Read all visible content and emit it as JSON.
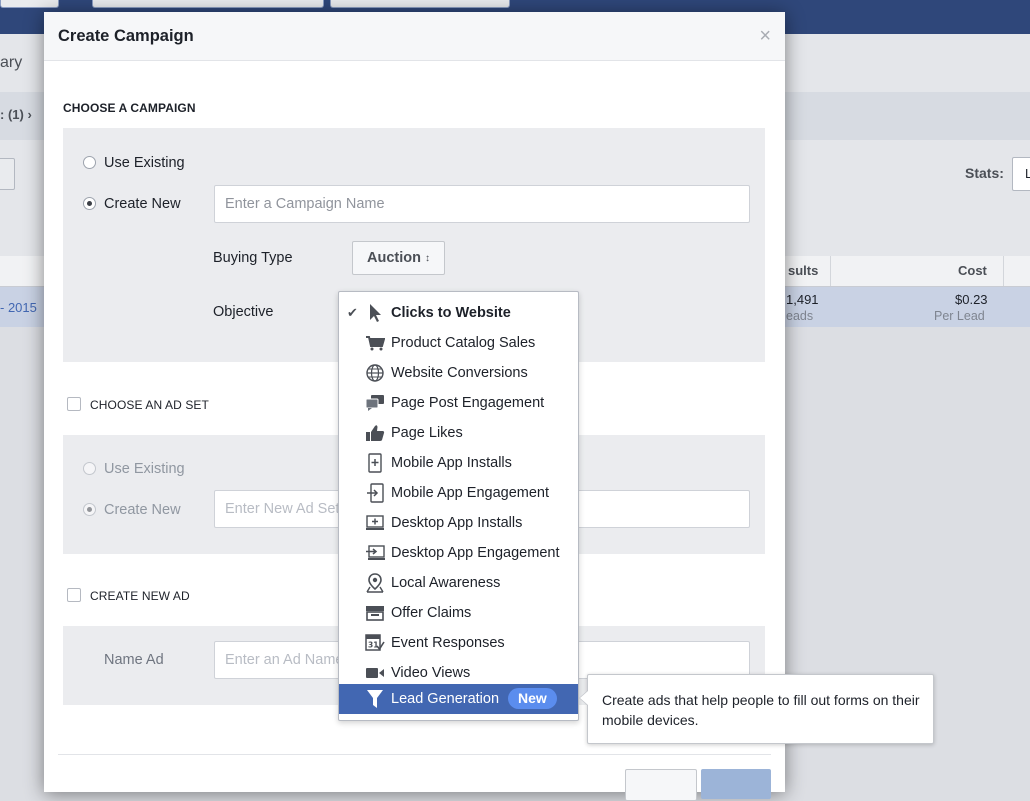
{
  "colors": {
    "brand_bar": "#2f477a",
    "hover_item": "#4267b2",
    "new_badge": "#5b8dee",
    "panel": "#ebecef"
  },
  "background": {
    "crumb_partial": "ary",
    "filter_partial": ":  (1) ›",
    "stats_label": "Stats:",
    "stats_select_partial": "L",
    "col_results_partial": "sults",
    "col_cost": "Cost",
    "row_date_partial": "- 2015",
    "row_results_value": "1,491",
    "row_results_unit": "eads",
    "row_cost_value": "$0.23",
    "row_cost_unit": "Per Lead"
  },
  "modal": {
    "title": "Create Campaign",
    "close_glyph": "×",
    "campaign": {
      "section_label": "CHOOSE A CAMPAIGN",
      "use_existing": "Use Existing",
      "create_new": "Create New",
      "name_placeholder": "Enter a Campaign Name",
      "buying_type_label": "Buying Type",
      "buying_type_value": "Auction",
      "objective_label": "Objective"
    },
    "adset": {
      "section_label": "CHOOSE AN AD SET",
      "use_existing": "Use Existing",
      "create_new": "Create New",
      "name_placeholder": "Enter New Ad Set Name"
    },
    "ad": {
      "section_label": "CREATE NEW AD",
      "name_label": "Name Ad",
      "name_placeholder": "Enter an Ad Name"
    }
  },
  "objective_dropdown": {
    "items": [
      {
        "label": "Clicks to Website",
        "icon": "cursor-icon",
        "selected": true
      },
      {
        "label": "Product Catalog Sales",
        "icon": "cart-icon"
      },
      {
        "label": "Website Conversions",
        "icon": "globe-icon"
      },
      {
        "label": "Page Post Engagement",
        "icon": "speech-bubbles-icon"
      },
      {
        "label": "Page Likes",
        "icon": "thumbs-up-icon"
      },
      {
        "label": "Mobile App Installs",
        "icon": "mobile-install-icon"
      },
      {
        "label": "Mobile App Engagement",
        "icon": "mobile-engage-icon"
      },
      {
        "label": "Desktop App Installs",
        "icon": "desktop-install-icon"
      },
      {
        "label": "Desktop App Engagement",
        "icon": "desktop-engage-icon"
      },
      {
        "label": "Local Awareness",
        "icon": "location-pin-icon"
      },
      {
        "label": "Offer Claims",
        "icon": "storefront-icon"
      },
      {
        "label": "Event Responses",
        "icon": "calendar-icon"
      },
      {
        "label": "Video Views",
        "icon": "video-camera-icon"
      },
      {
        "label": "Lead Generation",
        "icon": "funnel-icon",
        "highlighted": true,
        "badge": "New"
      }
    ]
  },
  "tooltip": {
    "text": "Create ads that help people to fill out forms on their mobile devices."
  }
}
